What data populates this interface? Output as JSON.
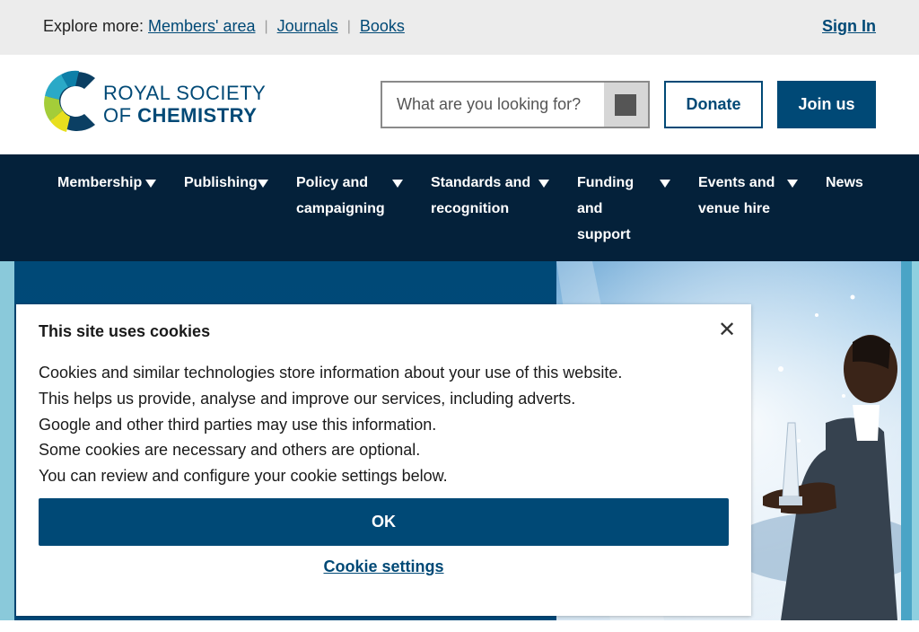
{
  "topbar": {
    "explore_label": "Explore more:",
    "links": [
      "Members' area",
      "Journals",
      "Books"
    ],
    "sign_in": "Sign In"
  },
  "header": {
    "logo_line1": "ROYAL SOCIETY",
    "logo_line2_prefix": "OF ",
    "logo_line2_bold": "CHEMISTRY",
    "search_placeholder": "What are you looking for?",
    "search_button_icon": "search-icon",
    "donate": "Donate",
    "join": "Join us"
  },
  "nav": {
    "items": [
      {
        "line1": "Membership",
        "line2": "",
        "line3": ""
      },
      {
        "line1": "Publishing",
        "line2": "",
        "line3": ""
      },
      {
        "line1": "Policy and",
        "line2": "campaigning",
        "line3": ""
      },
      {
        "line1": "Standards and",
        "line2": "recognition",
        "line3": ""
      },
      {
        "line1": "Funding",
        "line2": "and",
        "line3": "support"
      },
      {
        "line1": "Events and",
        "line2": "venue hire",
        "line3": ""
      },
      {
        "line1": "News",
        "line2": "",
        "line3": ""
      }
    ]
  },
  "cookie": {
    "title": "This site uses cookies",
    "lines": [
      "Cookies and similar technologies store information about your use of this website.",
      "This helps us provide, analyse and improve our services, including adverts.",
      "Google and other third parties may use this information.",
      "Some cookies are necessary and others are optional.",
      "You can review and configure your cookie settings below."
    ],
    "ok": "OK",
    "settings": "Cookie settings",
    "close_icon": "close-icon"
  },
  "colors": {
    "brand_blue": "#004976",
    "nav_bg": "#04213a",
    "topbar_bg": "#ececec"
  }
}
